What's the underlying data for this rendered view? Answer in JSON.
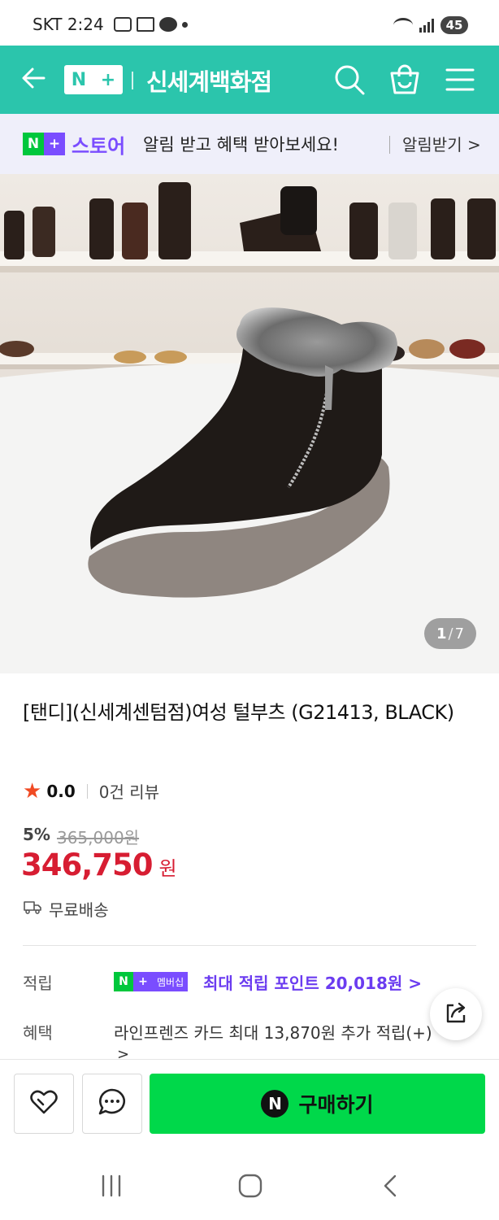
{
  "status_bar": {
    "carrier_time": "SKT 2:24",
    "battery": "45"
  },
  "header": {
    "logo_n": "N",
    "logo_plus": "+",
    "title": "신세계백화점",
    "brand_color": "#2bc5ac"
  },
  "store_banner": {
    "badge_n": "N",
    "badge_plus": "+",
    "store_label": "스토어",
    "message": "알림 받고 혜택 받아보세요!",
    "link": "알림받기 >"
  },
  "product": {
    "image_counter_current": "1",
    "image_counter_sep": "/",
    "image_counter_total": "7",
    "name": "[탠디](신세계센텀점)여성 털부츠 (G21413, BLACK)",
    "rating": "0.0",
    "review_count": "0건 리뷰",
    "discount_rate": "5%",
    "original_price": "365,000원",
    "price": "346,750",
    "price_unit": "원",
    "shipping": "무료배송"
  },
  "info": {
    "points_label": "적립",
    "member_badge_n": "N",
    "member_badge_plus": "+",
    "member_badge_text": "멤버십",
    "points_text": "최대 적립 포인트 20,018원 >",
    "benefit_label": "혜택",
    "benefit_text": "라인프렌즈 카드 최대 13,870원 추가 적립(+)",
    "benefit_more": ">"
  },
  "action_bar": {
    "buy_badge": "N",
    "buy_label": "구매하기",
    "buy_color": "#00d84a"
  },
  "icons": [
    "back-arrow-icon",
    "search-icon",
    "shopping-bag-icon",
    "menu-icon",
    "star-icon",
    "truck-icon",
    "share-icon",
    "heart-icon",
    "chat-icon",
    "recent-apps-icon",
    "home-icon",
    "back-icon"
  ]
}
